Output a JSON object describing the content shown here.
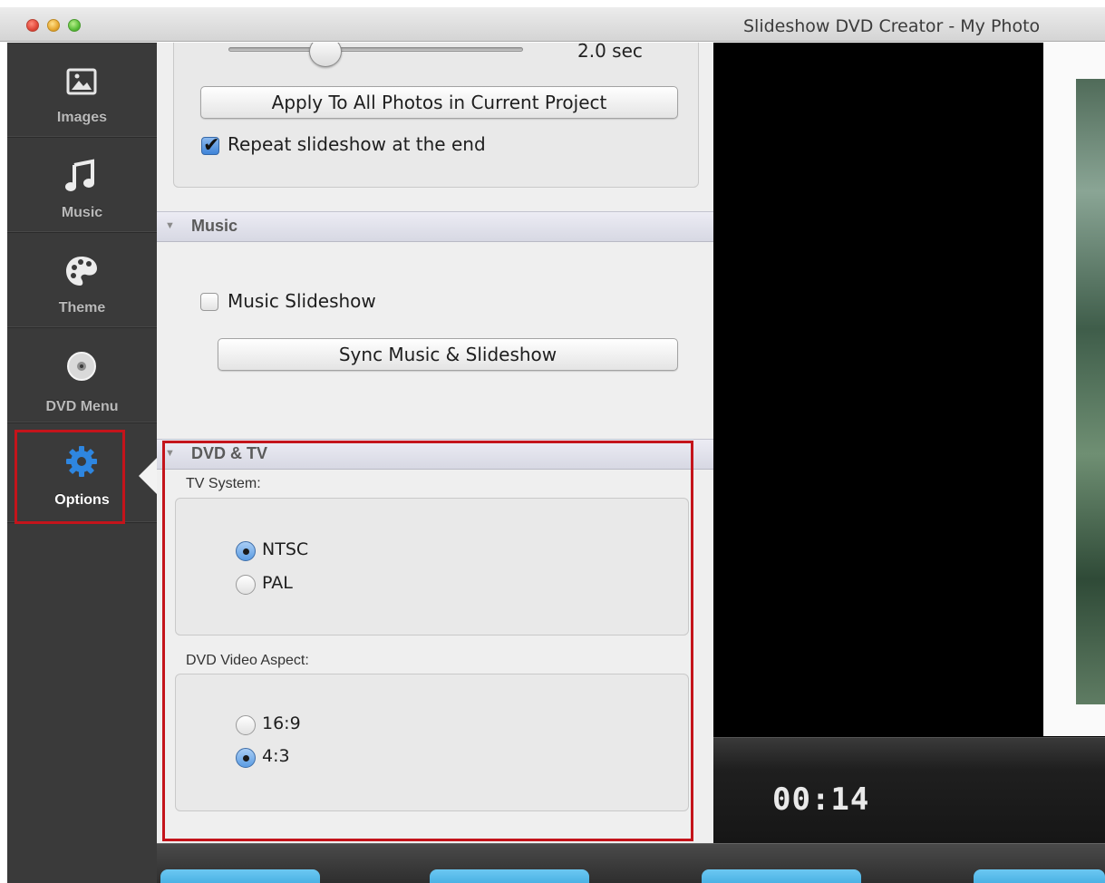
{
  "window": {
    "title": "Slideshow DVD Creator - My Photo"
  },
  "sidebar": {
    "items": [
      {
        "label": "Images",
        "icon": "image-icon"
      },
      {
        "label": "Music",
        "icon": "music-note-icon"
      },
      {
        "label": "Theme",
        "icon": "palette-icon"
      },
      {
        "label": "DVD Menu",
        "icon": "disc-icon"
      },
      {
        "label": "Options",
        "icon": "gear-icon",
        "active": true
      }
    ]
  },
  "options": {
    "slideshow": {
      "duration_value": "2.0 sec",
      "apply_all_label": "Apply To All Photos in Current Project",
      "repeat_label": "Repeat slideshow at the end",
      "repeat_checked": true
    },
    "music": {
      "header": "Music",
      "music_slideshow_label": "Music Slideshow",
      "music_slideshow_checked": false,
      "sync_label": "Sync Music & Slideshow"
    },
    "dvd_tv": {
      "header": "DVD & TV",
      "tv_system_label": "TV System:",
      "tv_options": [
        "NTSC",
        "PAL"
      ],
      "tv_selected": "NTSC",
      "aspect_label": "DVD Video Aspect:",
      "aspect_options": [
        "16:9",
        "4:3"
      ],
      "aspect_selected": "4:3"
    }
  },
  "preview": {
    "timecode": "00:14"
  },
  "colors": {
    "highlight": "#c4141b",
    "options_icon": "#2e86e0",
    "bottom_buttons": "#3fa9e0"
  }
}
